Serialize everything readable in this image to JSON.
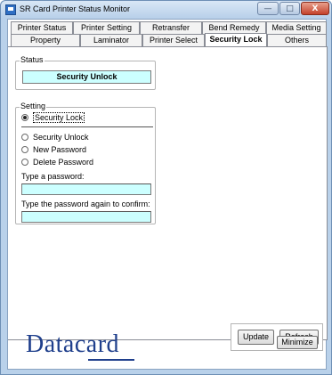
{
  "window": {
    "title": "SR Card Printer Status Monitor",
    "minimize_glyph": "—",
    "maximize_glyph": "□",
    "close_glyph": "X"
  },
  "tabs_row1": [
    "Printer Status",
    "Printer Setting",
    "Retransfer",
    "Bend Remedy",
    "Media Setting"
  ],
  "tabs_row2": [
    "Property",
    "Laminator",
    "Printer Select",
    "Security Lock",
    "Others"
  ],
  "active_tab": "Security Lock",
  "status": {
    "group_label": "Status",
    "value": "Security Unlock"
  },
  "setting": {
    "group_label": "Setting",
    "options": [
      {
        "label": "Security Lock",
        "checked": true
      },
      {
        "label": "Security Unlock",
        "checked": false
      },
      {
        "label": "New Password",
        "checked": false
      },
      {
        "label": "Delete Password",
        "checked": false
      }
    ],
    "password_label": "Type a password:",
    "password_value": "",
    "confirm_label": "Type the password again to confirm:",
    "confirm_value": ""
  },
  "buttons": {
    "update": "Update",
    "refresh": "Refresh",
    "minimize": "Minimize"
  },
  "logo": {
    "text": "Datacard",
    "color": "#1f3f8c"
  },
  "colors": {
    "field_bg": "#ccffff"
  }
}
